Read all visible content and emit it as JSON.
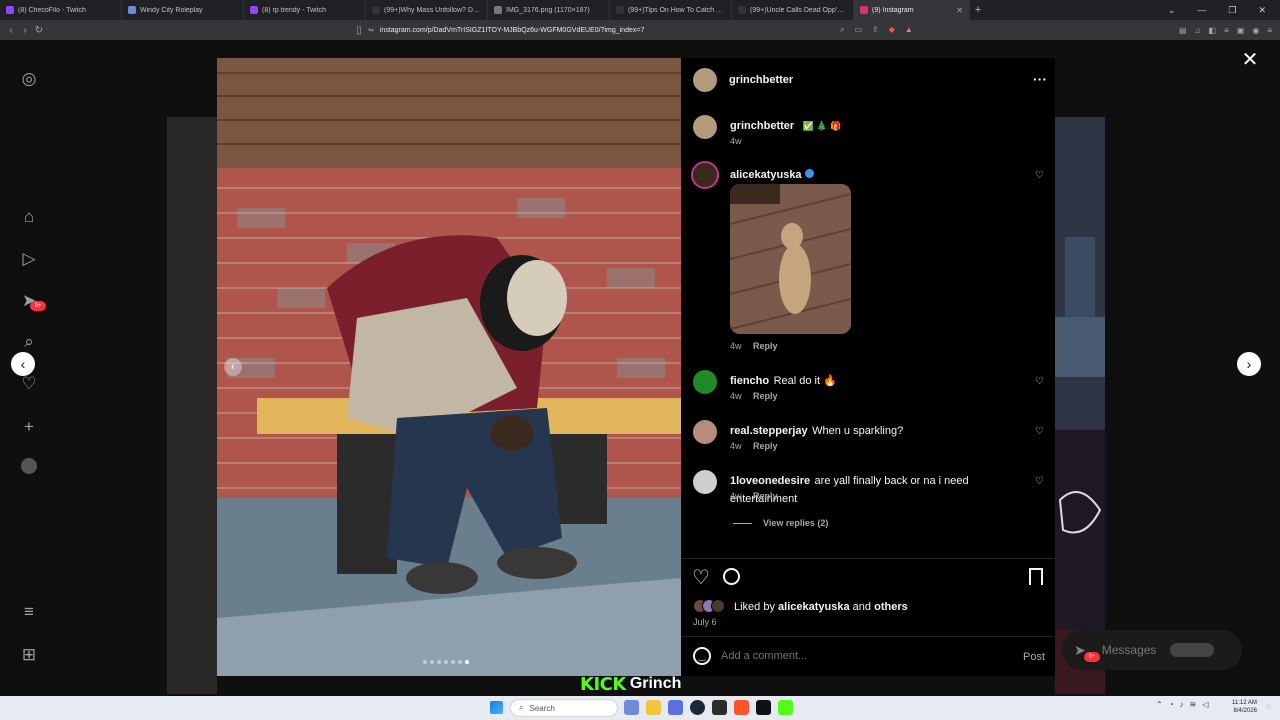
{
  "browser": {
    "tabs": [
      {
        "label": "(8) ChecoFilo - Twitch",
        "active": false
      },
      {
        "label": "Windy City Roleplay",
        "active": false
      },
      {
        "label": "(8) rp trendy - Twitch",
        "active": false
      },
      {
        "label": "(99+)Why Mass Unfollow? Didi Fayb...",
        "active": false
      },
      {
        "label": "IMG_3176.png (1170×187)",
        "active": false
      },
      {
        "label": "(99+)Tips On How To Catch A ⌛ Ti",
        "active": false
      },
      {
        "label": "(99+)Uncle Calls Dead Opp's Mom i...",
        "active": false
      },
      {
        "label": "(9) Instagram",
        "active": true
      }
    ],
    "url": "instagram.com/p/DadVmTrISIGZ1ITOY-MJBbQz6u-WGFM0GVdEUE0/?img_index=7"
  },
  "post": {
    "author": "grinchbetter",
    "caption_username": "grinchbetter",
    "caption_emojis": "✅ 🎄 🎁",
    "caption_time": "4w",
    "more_label": "···",
    "comments": [
      {
        "username": "alicekatyuska",
        "verified": true,
        "text": "",
        "time": "4w",
        "reply": "Reply",
        "has_image": true
      },
      {
        "username": "fiencho",
        "text": "Real do it 🔥",
        "time": "4w",
        "reply": "Reply"
      },
      {
        "username": "real.stepperjay",
        "text": "When u sparkling?",
        "time": "4w",
        "reply": "Reply"
      },
      {
        "username": "1loveonedesire",
        "text": "are yall finally back or na i need entertainment",
        "time": "4w",
        "reply": "Reply"
      }
    ],
    "view_replies": "View replies (2)",
    "liked_by_prefix": "Liked by",
    "liked_by_user": "alicekatyuska",
    "liked_by_and": "and",
    "liked_by_others": "others",
    "date": "July 6",
    "comment_placeholder": "Add a comment...",
    "post_button": "Post",
    "carousel_dots_total": 7,
    "carousel_active_index": 7
  },
  "messages": {
    "label": "Messages",
    "badge": "9+"
  },
  "left_nav": {
    "notification_badge": "9+"
  },
  "stream_overlay": {
    "kick": "KICK",
    "name": "Grinch"
  },
  "taskbar": {
    "search_placeholder": "Search",
    "time": "11:12 AM",
    "date": "8/4/2026"
  },
  "colors": {
    "instagram_bg": "#000000",
    "kick_green": "#53fc18",
    "link_blue": "#3897f0",
    "badge_red": "#ff3040"
  }
}
